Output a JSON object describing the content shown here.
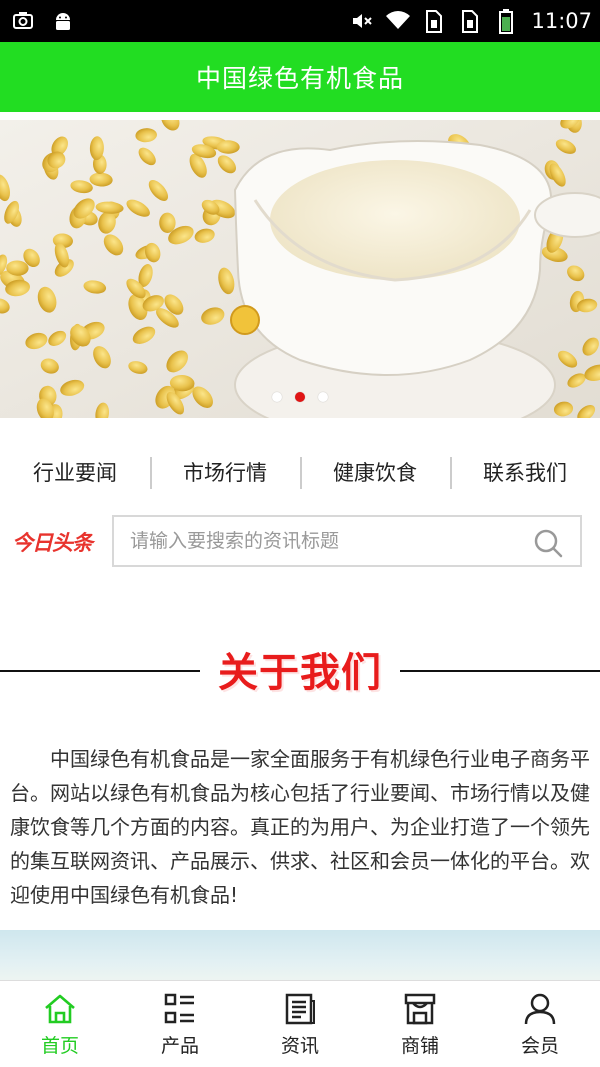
{
  "status_bar": {
    "time": "11:07"
  },
  "header": {
    "title": "中国绿色有机食品"
  },
  "banner": {
    "active_index": 1,
    "slide_count": 3
  },
  "categories": [
    {
      "label": "行业要闻"
    },
    {
      "label": "市场行情"
    },
    {
      "label": "健康饮食"
    },
    {
      "label": "联系我们"
    }
  ],
  "search": {
    "logo_text": "今日头条",
    "placeholder": "请输入要搜索的资讯标题"
  },
  "about": {
    "title": "关于我们",
    "text": "中国绿色有机食品是一家全面服务于有机绿色行业电子商务平台。网站以绿色有机食品为核心包括了行业要闻、市场行情以及健康饮食等几个方面的内容。真正的为用户、为企业打造了一个领先的集互联网资讯、产品展示、供求、社区和会员一体化的平台。欢迎使用中国绿色有机食品!"
  },
  "tabbar": {
    "active_color": "#22cc22",
    "items": [
      {
        "label": "首页",
        "icon": "home-icon",
        "active": true
      },
      {
        "label": "产品",
        "icon": "grid-list-icon",
        "active": false
      },
      {
        "label": "资讯",
        "icon": "newspaper-icon",
        "active": false
      },
      {
        "label": "商铺",
        "icon": "store-icon",
        "active": false
      },
      {
        "label": "会员",
        "icon": "user-icon",
        "active": false
      }
    ]
  },
  "colors": {
    "header": "#22dd22",
    "about_title": "#e81c1c",
    "dot_active": "#e01414"
  }
}
